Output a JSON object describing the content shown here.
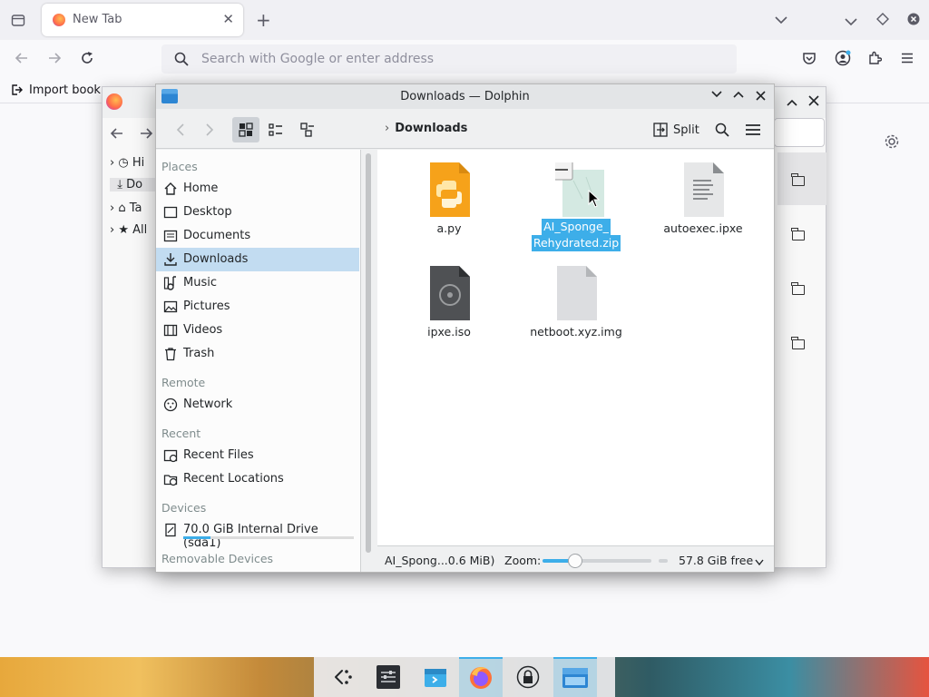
{
  "browser": {
    "tab_title": "New Tab",
    "url_placeholder": "Search with Google or enter address",
    "bookmark_import_label": "Import book"
  },
  "library_window": {
    "tree": [
      "Hi",
      "Do",
      "Ta",
      "All"
    ]
  },
  "dolphin": {
    "title": "Downloads — Dolphin",
    "breadcrumb": "Downloads",
    "split_label": "Split",
    "places": {
      "headers": {
        "places": "Places",
        "remote": "Remote",
        "recent": "Recent",
        "devices": "Devices",
        "removable": "Removable Devices"
      },
      "items": [
        {
          "label": "Home",
          "icon": "home-icon"
        },
        {
          "label": "Desktop",
          "icon": "desktop-icon"
        },
        {
          "label": "Documents",
          "icon": "documents-icon"
        },
        {
          "label": "Downloads",
          "icon": "download-icon",
          "selected": true
        },
        {
          "label": "Music",
          "icon": "music-icon"
        },
        {
          "label": "Pictures",
          "icon": "pictures-icon"
        },
        {
          "label": "Videos",
          "icon": "videos-icon"
        },
        {
          "label": "Trash",
          "icon": "trash-icon"
        }
      ],
      "remote": [
        {
          "label": "Network",
          "icon": "network-icon"
        }
      ],
      "recent": [
        {
          "label": "Recent Files",
          "icon": "recent-files-icon"
        },
        {
          "label": "Recent Locations",
          "icon": "recent-locations-icon"
        }
      ],
      "devices": [
        {
          "label": "70.0 GiB Internal Drive (sda1)",
          "icon": "drive-icon",
          "used_fraction": 0.16
        }
      ]
    },
    "files": [
      {
        "name": "a.py",
        "type": "python"
      },
      {
        "name_line1": "AI_Sponge_",
        "name_line2": "Rehydrated.zip",
        "type": "zip",
        "selected": true
      },
      {
        "name": "autoexec.ipxe",
        "type": "text"
      },
      {
        "name": "ipxe.iso",
        "type": "iso"
      },
      {
        "name": "netboot.xyz.img",
        "type": "img"
      }
    ],
    "status": {
      "selection": "AI_Spong...0.6 MiB)",
      "zoom_label": "Zoom:",
      "zoom_fraction": 0.3,
      "free_space": "57.8 GiB free"
    }
  },
  "colors": {
    "accent": "#3daee9",
    "selection_bg": "#c2dcf1"
  }
}
